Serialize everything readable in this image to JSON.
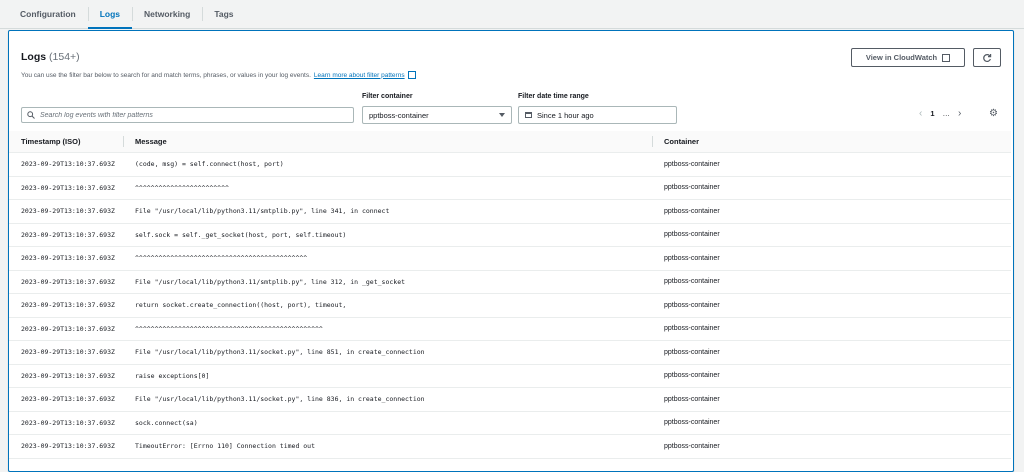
{
  "tabs": [
    "Configuration",
    "Logs",
    "Networking",
    "Tags"
  ],
  "active_tab": "Logs",
  "logs": {
    "title": "Logs",
    "count": "(154+)",
    "description": "You can use the filter bar below to search for and match terms, phrases, or values in your log events.",
    "learn_more": "Learn more about filter patterns",
    "view_cloudwatch": "View in CloudWatch",
    "search_placeholder": "Search log events with filter patterns",
    "filter_container_label": "Filter container",
    "filter_container_value": "pptboss-container",
    "filter_date_label": "Filter date time range",
    "filter_date_value": "Since 1 hour ago",
    "page": "1",
    "page_more": "…",
    "columns": [
      "Timestamp (ISO)",
      "Message",
      "Container"
    ],
    "rows": [
      {
        "ts": "2023-09-29T13:10:37.693Z",
        "msg": "(code, msg) = self.connect(host, port)",
        "container": "pptboss-container"
      },
      {
        "ts": "2023-09-29T13:10:37.693Z",
        "msg": "^^^^^^^^^^^^^^^^^^^^^^^^",
        "container": "pptboss-container"
      },
      {
        "ts": "2023-09-29T13:10:37.693Z",
        "msg": "File \"/usr/local/lib/python3.11/smtplib.py\", line 341, in connect",
        "container": "pptboss-container"
      },
      {
        "ts": "2023-09-29T13:10:37.693Z",
        "msg": "self.sock = self._get_socket(host, port, self.timeout)",
        "container": "pptboss-container"
      },
      {
        "ts": "2023-09-29T13:10:37.693Z",
        "msg": "^^^^^^^^^^^^^^^^^^^^^^^^^^^^^^^^^^^^^^^^^^^^",
        "container": "pptboss-container"
      },
      {
        "ts": "2023-09-29T13:10:37.693Z",
        "msg": "File \"/usr/local/lib/python3.11/smtplib.py\", line 312, in _get_socket",
        "container": "pptboss-container"
      },
      {
        "ts": "2023-09-29T13:10:37.693Z",
        "msg": "return socket.create_connection((host, port), timeout,",
        "container": "pptboss-container"
      },
      {
        "ts": "2023-09-29T13:10:37.693Z",
        "msg": "^^^^^^^^^^^^^^^^^^^^^^^^^^^^^^^^^^^^^^^^^^^^^^^^",
        "container": "pptboss-container"
      },
      {
        "ts": "2023-09-29T13:10:37.693Z",
        "msg": "File \"/usr/local/lib/python3.11/socket.py\", line 851, in create_connection",
        "container": "pptboss-container"
      },
      {
        "ts": "2023-09-29T13:10:37.693Z",
        "msg": "raise exceptions[0]",
        "container": "pptboss-container"
      },
      {
        "ts": "2023-09-29T13:10:37.693Z",
        "msg": "File \"/usr/local/lib/python3.11/socket.py\", line 836, in create_connection",
        "container": "pptboss-container"
      },
      {
        "ts": "2023-09-29T13:10:37.693Z",
        "msg": "sock.connect(sa)",
        "container": "pptboss-container"
      },
      {
        "ts": "2023-09-29T13:10:37.693Z",
        "msg": "TimeoutError: [Errno 110] Connection timed out",
        "container": "pptboss-container"
      }
    ]
  },
  "colors": {
    "accent": "#0073bb",
    "text": "#16191f",
    "muted": "#545b64"
  },
  "icons": {
    "search": "search-icon",
    "external": "external-link-icon",
    "refresh": "refresh-icon",
    "settings": "gear-icon",
    "calendar": "calendar-icon"
  }
}
